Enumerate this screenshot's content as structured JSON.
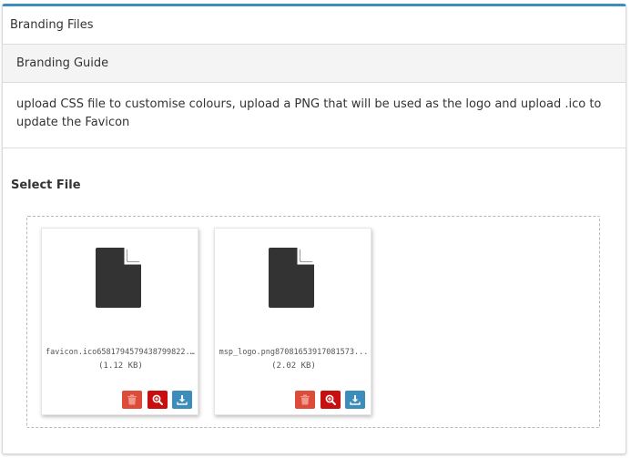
{
  "panel": {
    "title": "Branding Files"
  },
  "guide": {
    "heading": "Branding Guide",
    "text": "upload CSS file to customise colours, upload a PNG that will be used as the logo and upload .ico to update the Favicon"
  },
  "select": {
    "label": "Select File"
  },
  "files": [
    {
      "name": "favicon.ico65817945794387998​22.t...",
      "size": "(1.12 KB)",
      "icon": "file-icon"
    },
    {
      "name": "msp_logo.png87081653917081573...",
      "size": "(2.02 KB)",
      "icon": "file-icon"
    }
  ],
  "actions": {
    "delete_icon": "trash-icon",
    "zoom_icon": "zoom-in-icon",
    "download_icon": "download-icon"
  },
  "colors": {
    "accent": "#3c8dbc",
    "delete": "#dd4b39",
    "zoom": "#c70f0f",
    "download": "#3c8dbc"
  }
}
